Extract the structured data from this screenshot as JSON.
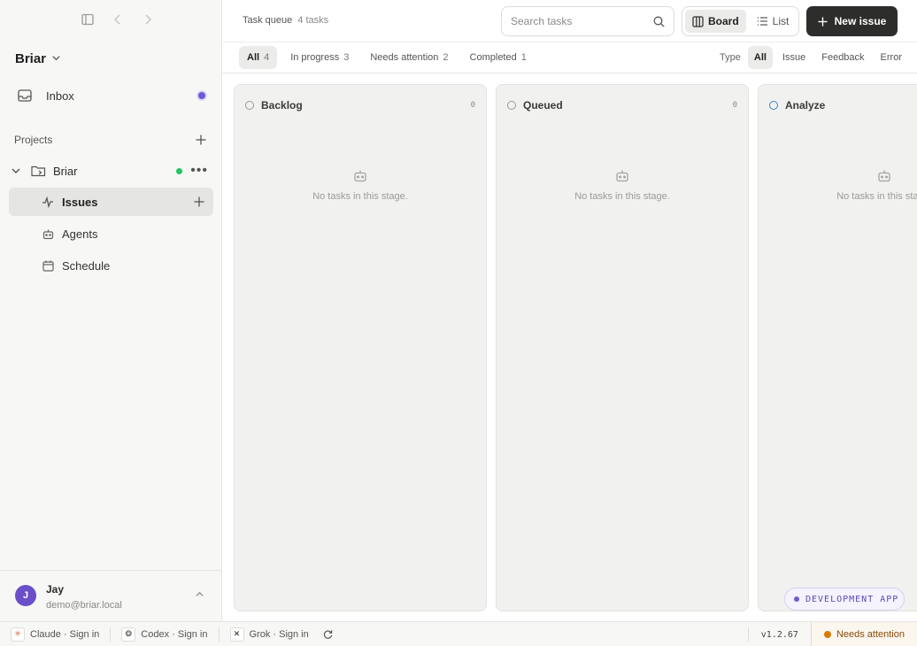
{
  "sidebar": {
    "workspace": "Briar",
    "inbox_label": "Inbox",
    "projects_label": "Projects",
    "project_name": "Briar",
    "nav": [
      {
        "label": "Issues",
        "icon": "activity-icon"
      },
      {
        "label": "Agents",
        "icon": "robot-icon"
      },
      {
        "label": "Schedule",
        "icon": "calendar-icon"
      }
    ],
    "user": {
      "initial": "J",
      "name": "Jay",
      "email": "demo@briar.local"
    }
  },
  "header": {
    "title": "Task queue",
    "count": "4 tasks",
    "search_placeholder": "Search tasks",
    "view_board": "Board",
    "view_list": "List",
    "new_issue": "New issue"
  },
  "filters": {
    "tabs": [
      {
        "label": "All",
        "count": "4"
      },
      {
        "label": "In progress",
        "count": "3"
      },
      {
        "label": "Needs attention",
        "count": "2"
      },
      {
        "label": "Completed",
        "count": "1"
      }
    ],
    "type_label": "Type",
    "types": [
      "All",
      "Issue",
      "Feedback",
      "Error"
    ]
  },
  "columns": [
    {
      "title": "Backlog",
      "count": "0",
      "empty": "No tasks in this stage."
    },
    {
      "title": "Queued",
      "count": "0",
      "empty": "No tasks in this stage."
    },
    {
      "title": "Analyze",
      "count": "",
      "empty": "No tasks in this stage."
    }
  ],
  "dev_badge": "DEVELOPMENT APP",
  "statusbar": {
    "claude": "Claude · Sign in",
    "codex": "Codex · Sign in",
    "grok": "Grok · Sign in",
    "version": "v1.2.67",
    "attention": "Needs attention"
  },
  "colors": {
    "accent": "#6b5cd6",
    "online": "#22c55e",
    "primary_button": "#2d2d2b",
    "attention": "#d97706"
  }
}
